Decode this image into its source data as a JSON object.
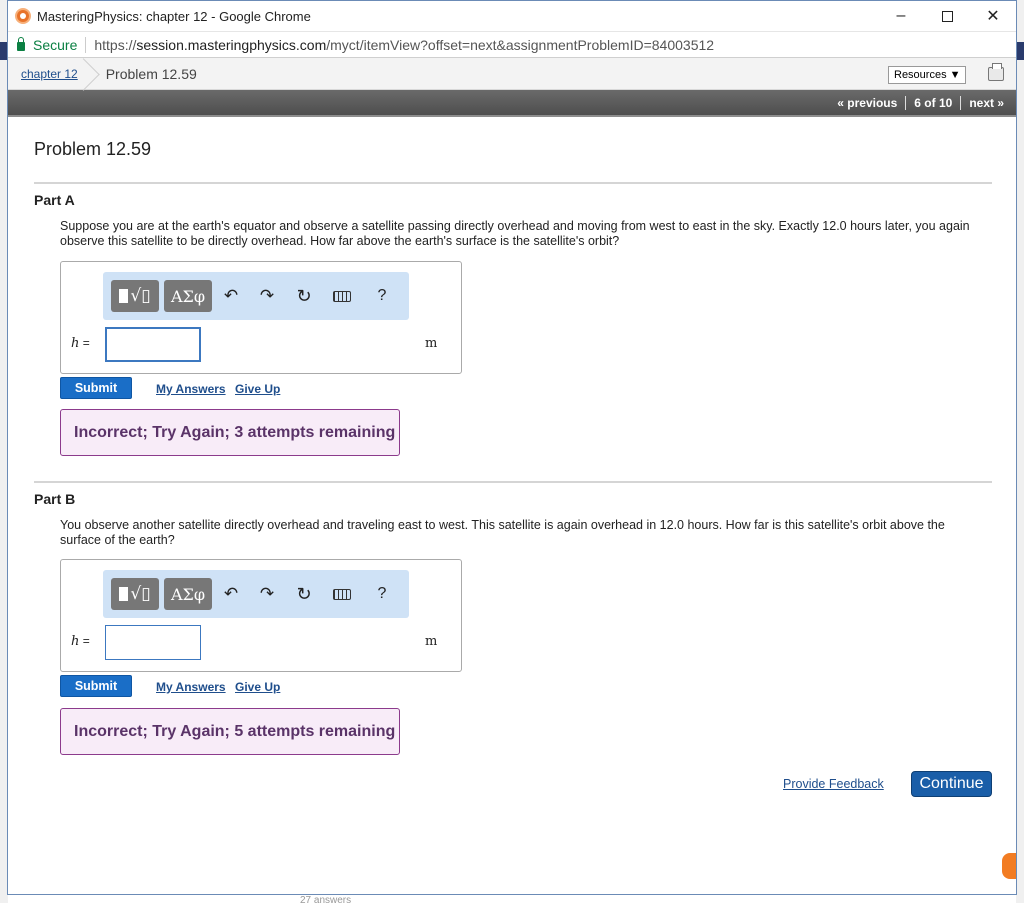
{
  "window": {
    "title": "MasteringPhysics: chapter 12 - Google Chrome",
    "controls": {
      "minimize": "–",
      "maximize": "",
      "close": "✕"
    }
  },
  "address": {
    "secure_label": "Secure",
    "url_scheme": "https://",
    "url_host": "session.masteringphysics.com",
    "url_path": "/myct/itemView?offset=next&assignmentProblemID=84003512"
  },
  "breadcrumb": {
    "chapter_link": "chapter 12",
    "current": "Problem 12.59",
    "resources_label": "Resources ▼"
  },
  "nav": {
    "previous": "« previous",
    "position": "6 of 10",
    "next": "next »"
  },
  "problem": {
    "title": "Problem 12.59",
    "parts": [
      {
        "label": "Part A",
        "question": "Suppose you are at the earth's equator and observe a satellite passing directly overhead and moving from west to east in the sky. Exactly 12.0 hours later, you again observe this satellite to be directly overhead. How far above the earth's surface is the satellite's orbit?",
        "variable": "h",
        "equals": " =",
        "answer_value": "",
        "unit": "m",
        "submit_label": "Submit",
        "my_answers_label": "My Answers",
        "give_up_label": "Give Up",
        "feedback": "Incorrect; Try Again; 3 attempts remaining"
      },
      {
        "label": "Part B",
        "question": "You observe another satellite directly overhead and traveling east to west. This satellite is again overhead in 12.0 hours. How far is this satellite's orbit above the surface of the earth?",
        "variable": "h",
        "equals": " =",
        "answer_value": "",
        "unit": "m",
        "submit_label": "Submit",
        "my_answers_label": "My Answers",
        "give_up_label": "Give Up",
        "feedback": "Incorrect; Try Again; 5 attempts remaining"
      }
    ]
  },
  "toolbar": {
    "template_label": "√▯",
    "greek_label": "ΑΣφ",
    "undo": "↶",
    "redo": "↷",
    "reset": "↻",
    "help": "?"
  },
  "footer": {
    "provide_feedback": "Provide Feedback",
    "continue_label": "Continue"
  },
  "background_text": "27 answers",
  "colors": {
    "submit_blue": "#1a6ec7",
    "feedback_border": "#8c3a8c",
    "feedback_bg": "#f8ecf8",
    "toolbar_bg": "#cfe2f6",
    "nav_bar": "#5a5a5a",
    "link": "#1f4e8c"
  }
}
